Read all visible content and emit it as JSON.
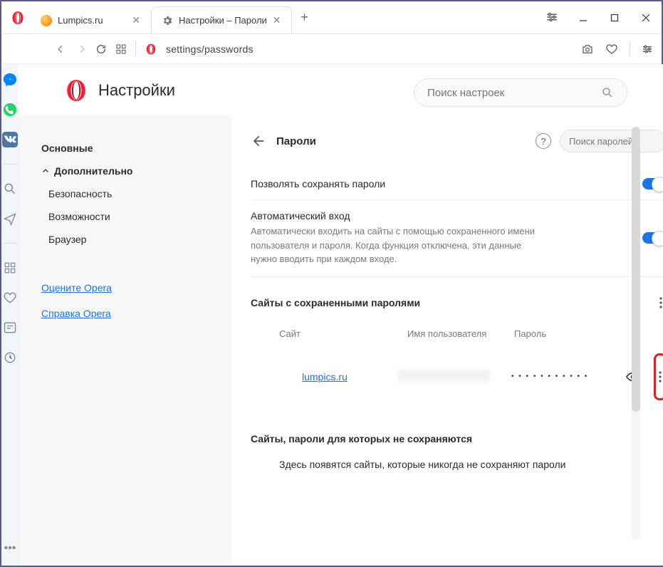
{
  "tabs": [
    {
      "label": "Lumpics.ru",
      "active": false
    },
    {
      "label": "Настройки – Пароли",
      "active": true
    }
  ],
  "url": "settings/passwords",
  "page": {
    "title": "Настройки",
    "search_placeholder": "Поиск настроек"
  },
  "sidebar": {
    "basic": "Основные",
    "advanced": "Дополнительно",
    "subs": [
      "Безопасность",
      "Возможности",
      "Браузер"
    ],
    "links": [
      "Оцените Opera",
      "Справка Opera"
    ]
  },
  "panel": {
    "title": "Пароли",
    "search_placeholder": "Поиск паролей",
    "allow_save": "Позволять сохранять пароли",
    "autologin_title": "Автоматический вход",
    "autologin_desc": "Автоматически входить на сайты с помощью сохраненного имени пользователя и пароля. Когда функция отключена, эти данные нужно вводить при каждом входе.",
    "saved_title": "Сайты с сохраненными паролями",
    "headers": {
      "site": "Сайт",
      "user": "Имя пользователя",
      "pass": "Пароль"
    },
    "rows": [
      {
        "site": "lumpics.ru",
        "password_mask": "• • • • • • • • • • •"
      }
    ],
    "never_title": "Сайты, пароли для которых не сохраняются",
    "never_empty": "Здесь появятся сайты, которые никогда не сохраняют пароли"
  }
}
